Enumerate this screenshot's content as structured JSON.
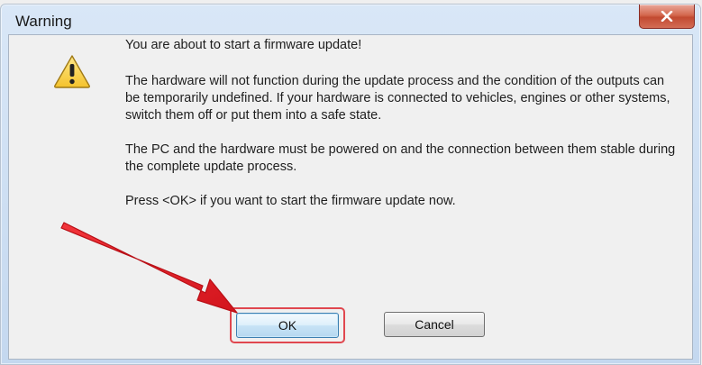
{
  "dialog": {
    "title": "Warning",
    "close_icon": "close-icon",
    "warning_icon": "warning-triangle-icon",
    "heading": "You are about to start a firmware update!",
    "paragraph1": "The hardware will not function during the update process and the condition of the outputs can be temporarily undefined. If your hardware is connected to vehicles, engines or other systems, switch them off or put them into a safe state.",
    "paragraph2": "The PC and the hardware must be powered on and the connection between them stable during the complete update process.",
    "paragraph3": "Press <OK> if you want to start the firmware update now.",
    "ok_label": "OK",
    "cancel_label": "Cancel"
  },
  "annotation": {
    "arrow_color": "#e8242c",
    "highlight_color": "#e0474f"
  }
}
